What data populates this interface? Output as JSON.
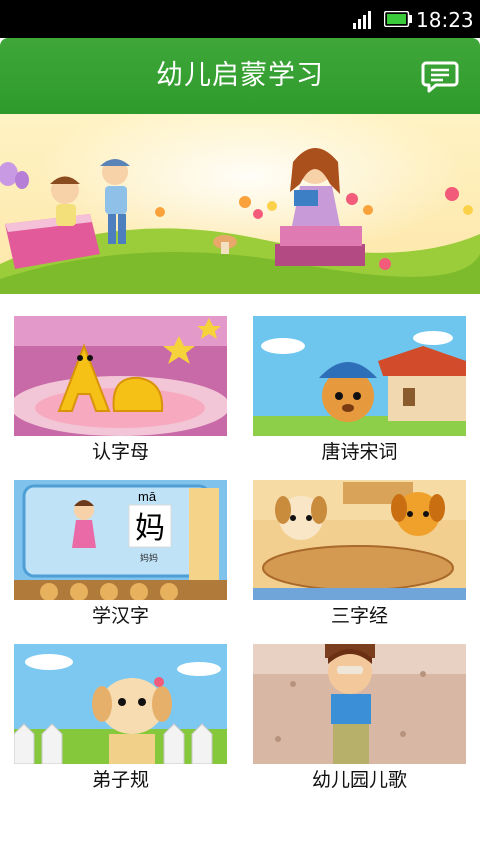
{
  "status": {
    "time": "18:23",
    "signal_icon": "signal-bars-icon",
    "battery_icon": "battery-charging-icon"
  },
  "header": {
    "title": "幼儿启蒙学习",
    "action_icon": "chat-bubble-icon",
    "background": "#35a030"
  },
  "banner": {
    "description_icon": "banner-illustration"
  },
  "tiles": [
    {
      "label": "认字母"
    },
    {
      "label": "唐诗宋词"
    },
    {
      "label": "学汉字",
      "pinyin": "mā",
      "char": "妈",
      "word": "妈妈"
    },
    {
      "label": "三字经"
    },
    {
      "label": "弟子规"
    },
    {
      "label": "幼儿园儿歌"
    }
  ]
}
